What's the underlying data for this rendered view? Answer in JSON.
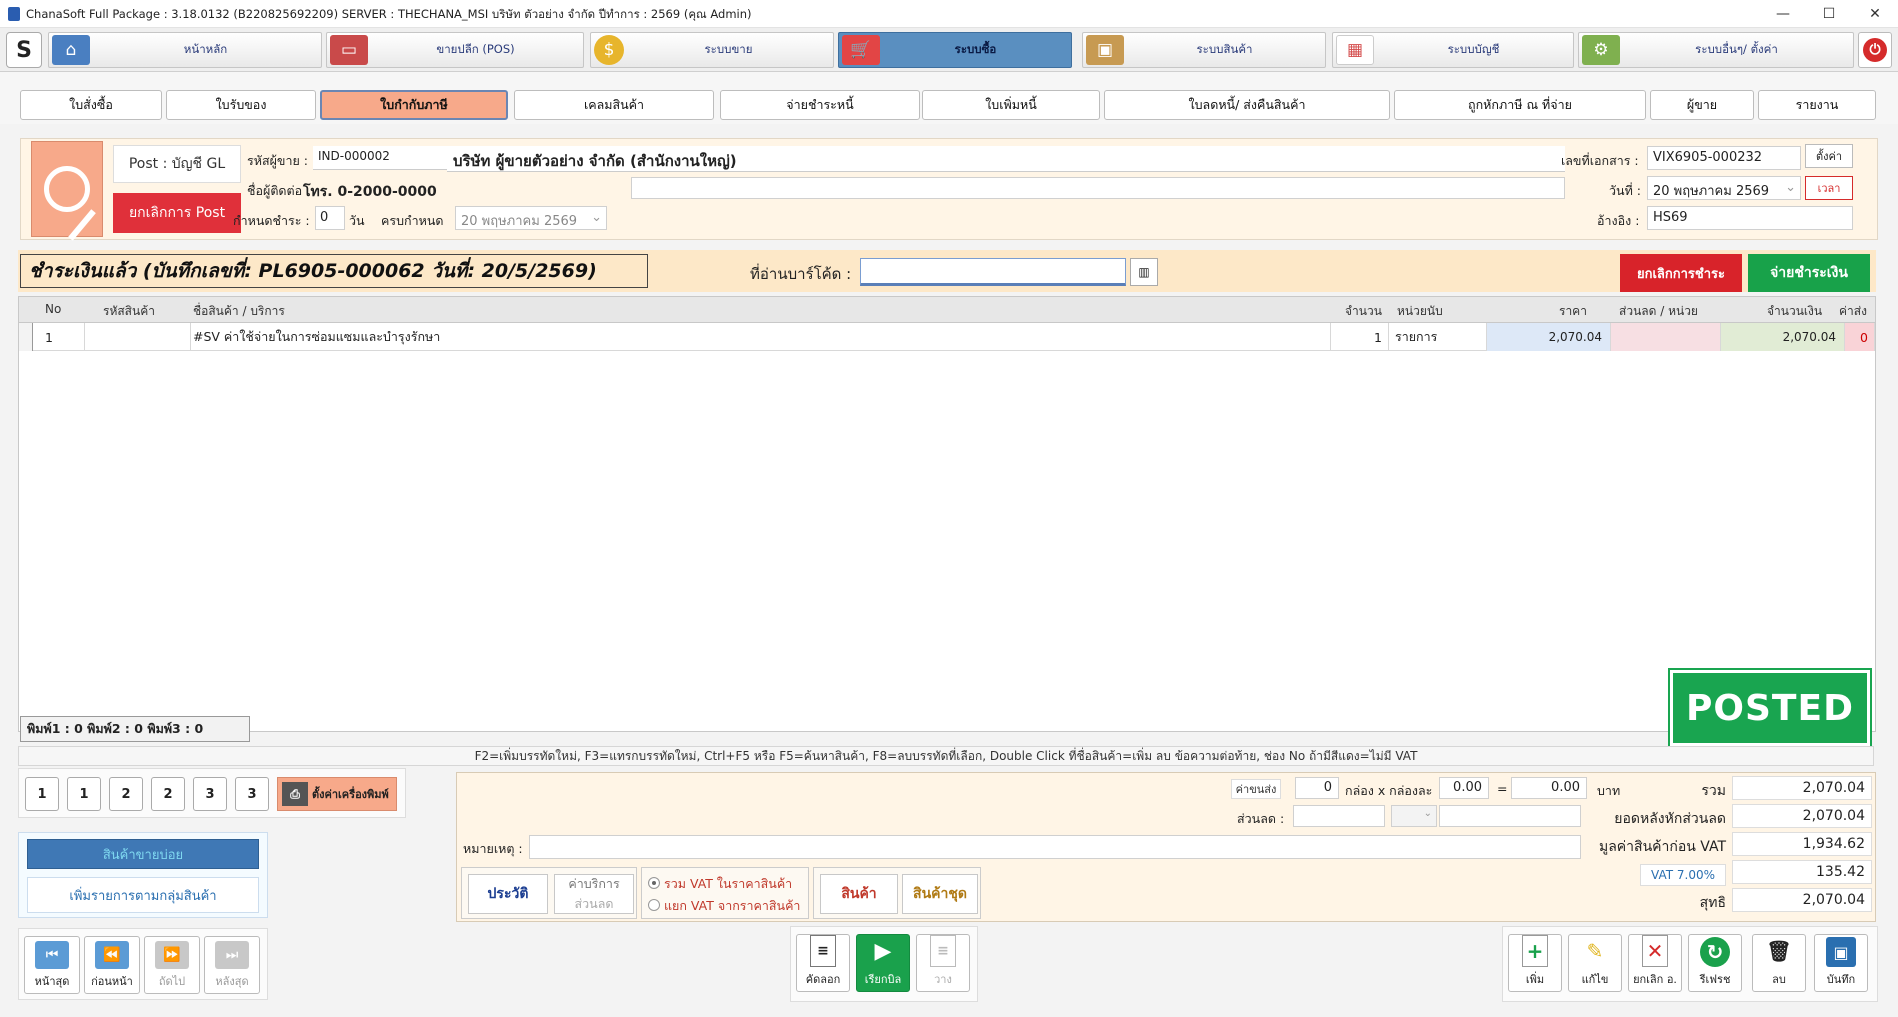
{
  "window": {
    "title": "ChanaSoft Full Package : 3.18.0132 (B220825692209) SERVER : THECHANA_MSI บริษัท ตัวอย่าง จำกัด ปีทำการ : 2569 (คุณ Admin)",
    "minimize": "—",
    "maximize": "☐",
    "close": "✕"
  },
  "nav": {
    "items": [
      {
        "label": "หน้าหลัก",
        "icon": "home-icon",
        "color": "#4a7fc1"
      },
      {
        "label": "ขายปลีก (POS)",
        "icon": "pos-terminal-icon",
        "color": "#c94a4a"
      },
      {
        "label": "ระบบขาย",
        "icon": "coin-icon",
        "color": "#e7b52c"
      },
      {
        "label": "ระบบซื้อ",
        "icon": "shopping-cart-icon",
        "color": "#e24545"
      },
      {
        "label": "ระบบสินค้า",
        "icon": "box-icon",
        "color": "#c79a52"
      },
      {
        "label": "ระบบบัญชี",
        "icon": "report-icon",
        "color": "#d44c4c"
      },
      {
        "label": "ระบบอื่นๆ/ ตั้งค่า",
        "icon": "gear-icon",
        "color": "#7fb04f"
      }
    ],
    "active_index": 3
  },
  "tabs": {
    "items": [
      "ใบสั่งซื้อ",
      "ใบรับของ",
      "ใบกำกับภาษี",
      "เคลมสินค้า",
      "จ่ายชำระหนี้",
      "ใบเพิ่มหนี้",
      "ใบลดหนี้/ ส่งคืนสินค้า",
      "ถูกหักภาษี ณ ที่จ่าย",
      "ผู้ขาย",
      "รายงาน"
    ],
    "active_index": 2
  },
  "header": {
    "post_label": "Post : บัญชี GL",
    "cancel_post": "ยกเลิกการ Post",
    "vendor_code_label": "รหัสผู้ขาย :",
    "vendor_code": "IND-000002",
    "vendor_name": "บริษัท ผู้ขายตัวอย่าง จำกัด (สำนักงานใหญ่)",
    "contact_label": "ชื่อผู้ติดต่อ",
    "contact_value": "โทร. 0-2000-0000",
    "due_label": "กำหนดชำระ :",
    "due_days": "0",
    "days_unit": "วัน",
    "due_date_label": "ครบกำหนด",
    "due_date": "20  พฤษภาคม   2569",
    "doc_no_label": "เลขที่เอกสาร :",
    "doc_no": "VIX6905-000232",
    "settings_btn": "ตั้งค่า",
    "date_label": "วันที่ :",
    "date_value": "20  พฤษภาคม   2569",
    "time_btn": "เวลา",
    "ref_label": "อ้างอิง :",
    "ref_value": "HS69"
  },
  "paidbar": {
    "status": "ชำระเงินแล้ว (บันทึกเลขที่: PL6905-000062 วันที่: 20/5/2569)",
    "barcode_label": "ที่อ่านบาร์โค้ด :",
    "barcode_value": "",
    "cancel_payment": "ยกเลิกการชำระ",
    "pay": "จ่ายชำระเงิน"
  },
  "grid": {
    "columns": [
      "No",
      "รหัสสินค้า",
      "ชื่อสินค้า / บริการ",
      "จำนวน",
      "หน่วยนับ",
      "ราคา",
      "ส่วนลด / หน่วย",
      "จำนวนเงิน",
      "ค่าส่ง"
    ],
    "rows": [
      {
        "no": "1",
        "code": "",
        "name": "#SV ค่าใช้จ่ายในการซ่อมแซมและบำรุงรักษา",
        "qty": "1",
        "unit": "รายการ",
        "price": "2,070.04",
        "discount": "",
        "amount": "2,070.04",
        "shipping": "0"
      }
    ]
  },
  "posted_stamp": "POSTED",
  "print_counts": "พิมพ์1 : 0    พิมพ์2 : 0    พิมพ์3 : 0",
  "hint": "F2=เพิ่มบรรทัดใหม่,   F3=แทรกบรรทัดใหม่,   Ctrl+F5 หรือ F5=ค้นหาสินค้า,   F8=ลบบรรทัดที่เลือก,   Double Click ที่ชื่อสินค้า=เพิ่ม ลบ ข้อความต่อท้าย,   ช่อง No ถ้ามีสีแดง=ไม่มี VAT",
  "print_buttons": [
    "1",
    "1",
    "2",
    "2",
    "3",
    "3"
  ],
  "printer_setup": "ตั้งค่าเครื่องพิมพ์",
  "side": {
    "popular": "สินค้าขายบ่อย",
    "add_group": "เพิ่มรายการตามกลุ่มสินค้า"
  },
  "footer": {
    "shipping_label": "ค่าขนส่ง",
    "boxes": "0",
    "box_x": "กล่อง x กล่องละ",
    "per_box": "0.00",
    "equals": "=",
    "ship_total": "0.00",
    "baht": "บาท",
    "discount_label": "ส่วนลด :",
    "note_label": "หมายเหตุ :",
    "history_btn": "ประวัติ",
    "service_btn_1": "ค่าบริการ",
    "service_btn_2": "ส่วนลด",
    "vat_incl": "รวม VAT ในราคาสินค้า",
    "vat_excl": "แยก VAT จากราคาสินค้า",
    "product_btn": "สินค้า",
    "product_set_btn": "สินค้าชุด"
  },
  "totals": [
    {
      "label": "รวม",
      "value": "2,070.04"
    },
    {
      "label": "ยอดหลังหักส่วนลด",
      "value": "2,070.04"
    },
    {
      "label": "มูลค่าสินค้าก่อน VAT",
      "value": "1,934.62"
    },
    {
      "label": "VAT 7.00%",
      "value": "135.42"
    },
    {
      "label": "สุทธิ",
      "value": "2,070.04"
    }
  ],
  "record_nav": {
    "first": "หน้าสุด",
    "prev": "ก่อนหน้า",
    "next": "ถัดไป",
    "last": "หลังสุด"
  },
  "center_actions": {
    "copy": "คัดลอก",
    "invoice": "เรียกบิล",
    "paste": "วาง"
  },
  "right_actions": {
    "add": "เพิ่ม",
    "edit": "แก้ไข",
    "cancel": "ยกเลิก อ.",
    "refresh": "รีเฟรช",
    "delete": "ลบ",
    "save": "บันทึก"
  }
}
